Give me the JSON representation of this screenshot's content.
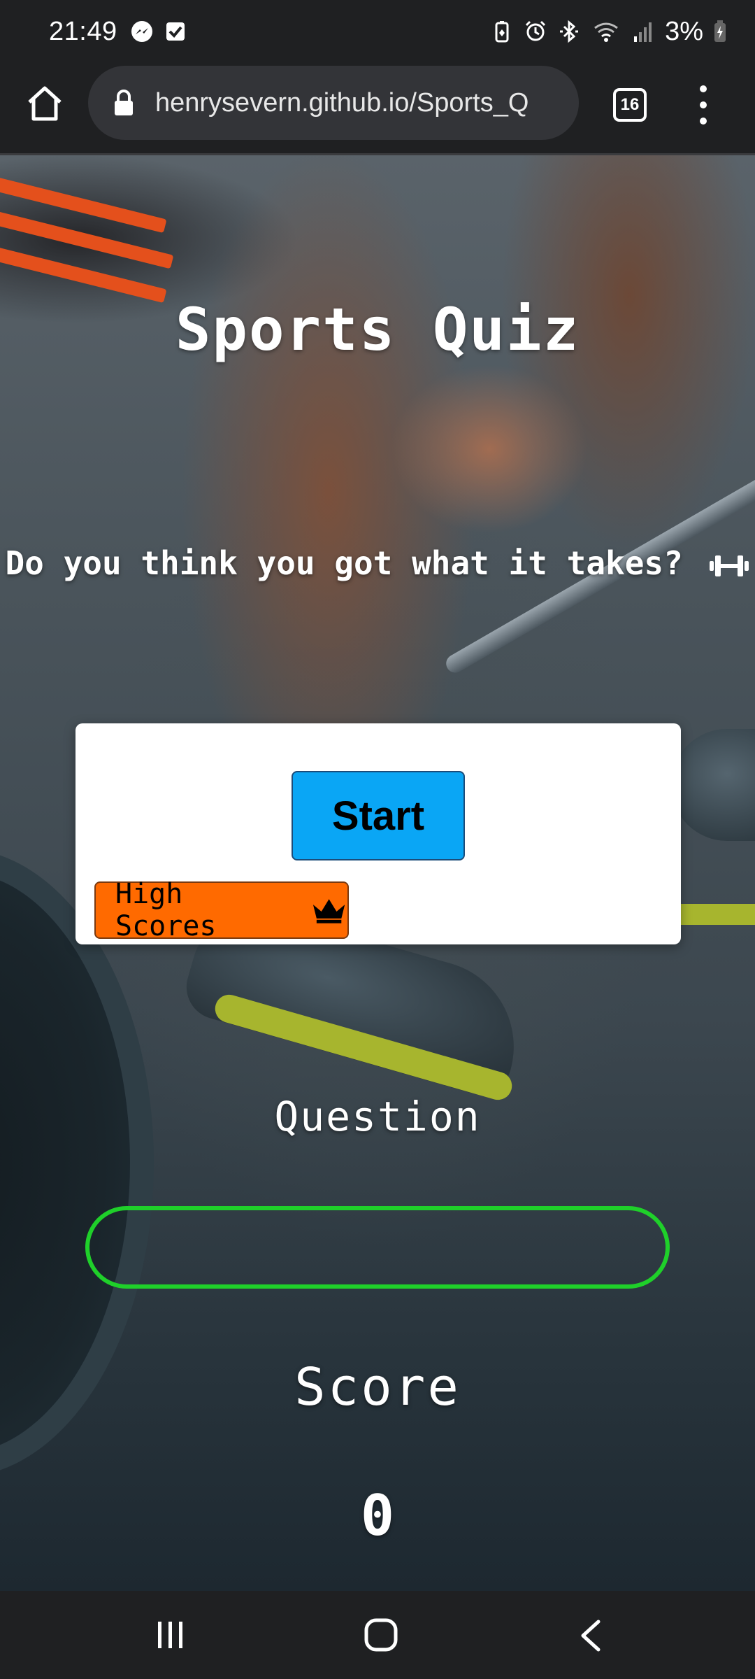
{
  "status_bar": {
    "time": "21:49",
    "battery": "3%",
    "left_icons": [
      "messenger-icon",
      "task-check-icon"
    ],
    "right_icons": [
      "battery-saver-icon",
      "alarm-icon",
      "bluetooth-icon",
      "wifi-icon",
      "signal-icon",
      "battery-charging-icon"
    ]
  },
  "browser": {
    "url": "henrysevern.github.io/Sports_Q",
    "tab_count": "16"
  },
  "page": {
    "title": "Sports Quiz",
    "subtitle": "Do you think you got what it takes?",
    "subtitle_icon": "dumbbell-icon",
    "start_button": "Start",
    "high_scores_button": "High Scores",
    "high_scores_icon": "crown-icon",
    "question_label": "Question",
    "answer_text": "",
    "score_label": "Score",
    "score_value": "0"
  },
  "colors": {
    "start_button": "#0aa6f5",
    "high_scores_button": "#ff6a00",
    "answer_border": "#1fd02a"
  }
}
